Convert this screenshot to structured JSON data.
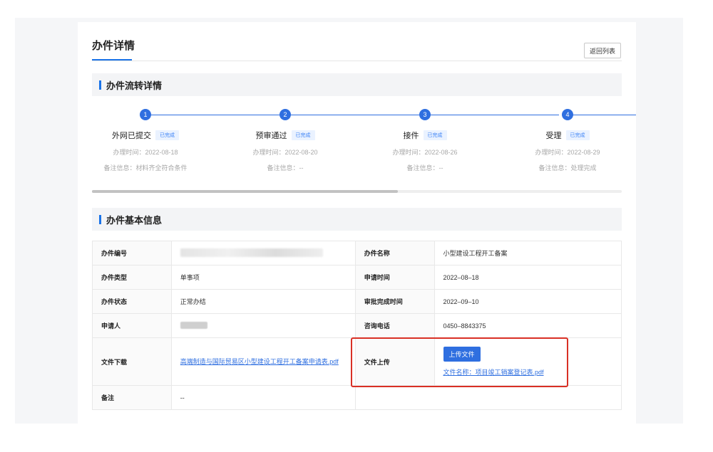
{
  "page": {
    "title": "办件详情",
    "back_button": "返回列表"
  },
  "flow_section": {
    "title": "办件流转详情",
    "steps": [
      {
        "number": "1",
        "name": "外网已提交",
        "status": "已完成",
        "time": "办理时间：2022-08-18",
        "note": "备注信息：材料齐全符合条件"
      },
      {
        "number": "2",
        "name": "预审通过",
        "status": "已完成",
        "time": "办理时间：2022-08-20",
        "note": "备注信息：--"
      },
      {
        "number": "3",
        "name": "接件",
        "status": "已完成",
        "time": "办理时间：2022-08-26",
        "note": "备注信息：--"
      },
      {
        "number": "4",
        "name": "受理",
        "status": "已完成",
        "time": "办理时间：2022-08-29",
        "note": "备注信息：处理完成"
      }
    ]
  },
  "info_section": {
    "title": "办件基本信息",
    "rows": {
      "case_no": {
        "label": "办件编号",
        "value": ""
      },
      "case_name": {
        "label": "办件名称",
        "value": "小型建设工程开工备案"
      },
      "case_type": {
        "label": "办件类型",
        "value": "单事项"
      },
      "apply_time": {
        "label": "申请时间",
        "value": "2022–08–18"
      },
      "case_status": {
        "label": "办件状态",
        "value": "正常办结"
      },
      "approve_time": {
        "label": "审批完成时间",
        "value": "2022–09–10"
      },
      "applicant": {
        "label": "申请人",
        "value": ""
      },
      "phone": {
        "label": "咨询电话",
        "value": "0450–8843375"
      },
      "download": {
        "label": "文件下载",
        "file": "高端制造与国际贸易区小型建设工程开工备案申请表.pdf"
      },
      "upload": {
        "label": "文件上传",
        "button": "上传文件",
        "file": "文件名称：项目竣工销案登记表.pdf"
      },
      "remark": {
        "label": "备注",
        "value": "--"
      }
    }
  },
  "colors": {
    "accent": "#2f6fe0",
    "highlight": "#d93025",
    "badge_bg": "#eaf2ff"
  }
}
